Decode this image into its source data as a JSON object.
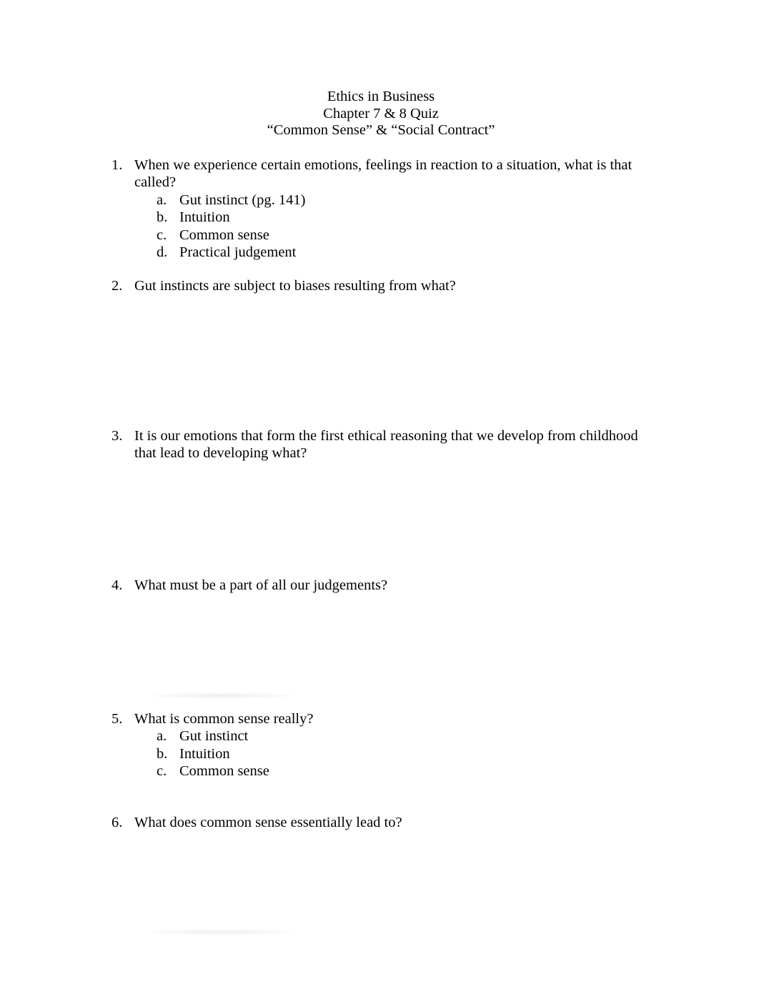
{
  "header": {
    "line1": "Ethics in Business",
    "line2": "Chapter 7 & 8 Quiz",
    "line3": "“Common Sense” & “Social Contract”"
  },
  "questions": [
    {
      "number": "1.",
      "text": "When we experience certain emotions, feelings in reaction to a situation, what is that called?",
      "options": [
        {
          "letter": "a.",
          "text": "Gut instinct (pg. 141)"
        },
        {
          "letter": "b.",
          "text": "Intuition"
        },
        {
          "letter": "c.",
          "text": "Common sense"
        },
        {
          "letter": "d.",
          "text": "Practical judgement"
        }
      ]
    },
    {
      "number": "2.",
      "text": "Gut instincts are subject to biases resulting from what?"
    },
    {
      "number": "3.",
      "text": "It is our emotions that form the first ethical reasoning that we develop from childhood that lead to developing what?"
    },
    {
      "number": "4.",
      "text": "What must be a part of all our judgements?"
    },
    {
      "number": "5.",
      "text": "What is common sense really?",
      "options": [
        {
          "letter": "a.",
          "text": "Gut instinct"
        },
        {
          "letter": "b.",
          "text": "Intuition"
        },
        {
          "letter": "c.",
          "text": "Common sense"
        }
      ]
    },
    {
      "number": "6.",
      "text": "What does common sense essentially lead to?"
    }
  ]
}
